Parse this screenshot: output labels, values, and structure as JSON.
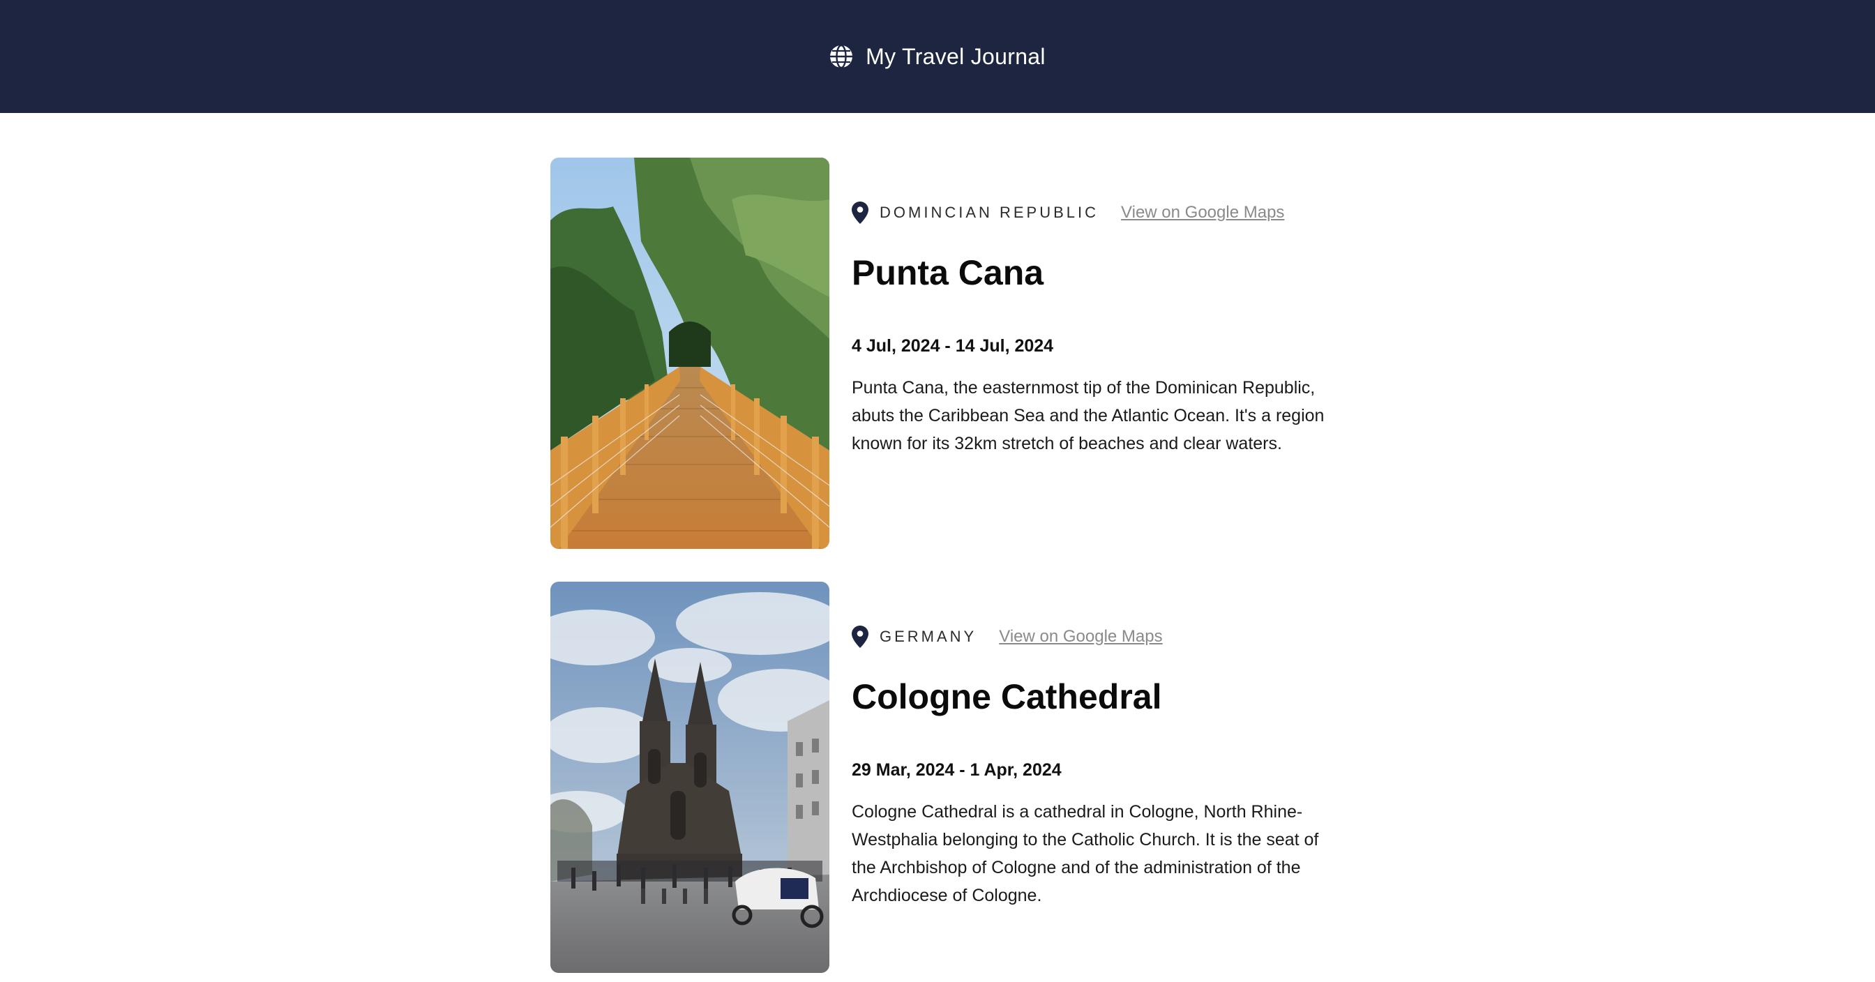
{
  "header": {
    "title": "My Travel Journal",
    "icon": "globe-icon"
  },
  "entries": [
    {
      "country": "DOMINCIAN REPUBLIC",
      "maps_link": "View on Google Maps",
      "title": "Punta Cana",
      "dates": "4 Jul, 2024 - 14 Jul, 2024",
      "description": "Punta Cana, the easternmost tip of the Dominican Republic, abuts the Caribbean Sea and the Atlantic Ocean. It's a region known for its 32km stretch of beaches and clear waters."
    },
    {
      "country": "GERMANY",
      "maps_link": "View on Google Maps",
      "title": "Cologne Cathedral",
      "dates": "29 Mar, 2024 - 1 Apr, 2024",
      "description": "Cologne Cathedral is a cathedral in Cologne, North Rhine-Westphalia belonging to the Catholic Church. It is the seat of the Archbishop of Cologne and of the administration of the Archdiocese of Cologne."
    }
  ],
  "colors": {
    "header_bg": "#1e2541",
    "pin": "#1e2541",
    "link": "#8a8a8a"
  }
}
